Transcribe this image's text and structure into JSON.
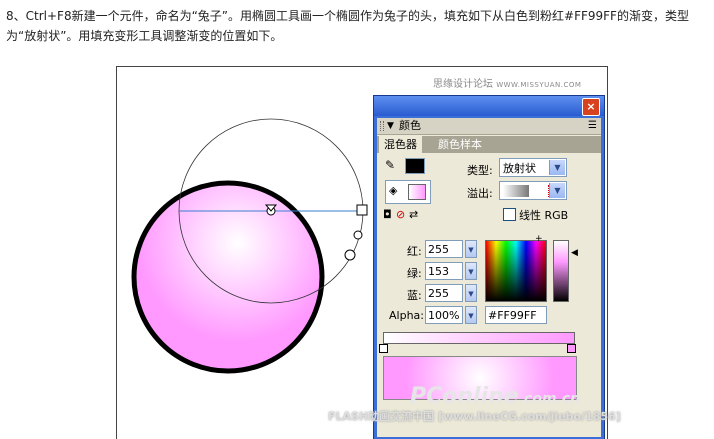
{
  "intro_text": "8、Ctrl+F8新建一个元件，命名为“兔子”。用椭圆工具画一个椭圆作为兔子的头，填充如下从白色到粉红#FF99FF的渐变，类型为“放射状”。用填充变形工具调整渐变的位置如下。",
  "watermark_top": {
    "cn": "思缘设计论坛",
    "url": "WWW.MISSYUAN.COM"
  },
  "colors": {
    "gradient_start": "#ffffff",
    "gradient_end": "#ff99ff",
    "stroke": "#000000",
    "panel_title": "#3b6ed6"
  },
  "panel": {
    "title": "颜色",
    "tabs": [
      "混色器",
      "颜色样本"
    ],
    "type_label": "类型:",
    "type_value": "放射状",
    "overflow_label": "溢出:",
    "linear_rgb_label": "线性 RGB",
    "red_label": "红:",
    "red_value": "255",
    "green_label": "绿:",
    "green_value": "153",
    "blue_label": "蓝:",
    "blue_value": "255",
    "alpha_label": "Alpha:",
    "alpha_value": "100%",
    "hex_value": "#FF99FF",
    "close_label": "×",
    "options_icon": "menu-options-icon"
  },
  "watermark_bottom": {
    "pconline": "PConline",
    "pconline_suffix": ".com.cn",
    "text": "FLASH动画交流中国 [www.lineCG.com/jiebo/1856]"
  }
}
